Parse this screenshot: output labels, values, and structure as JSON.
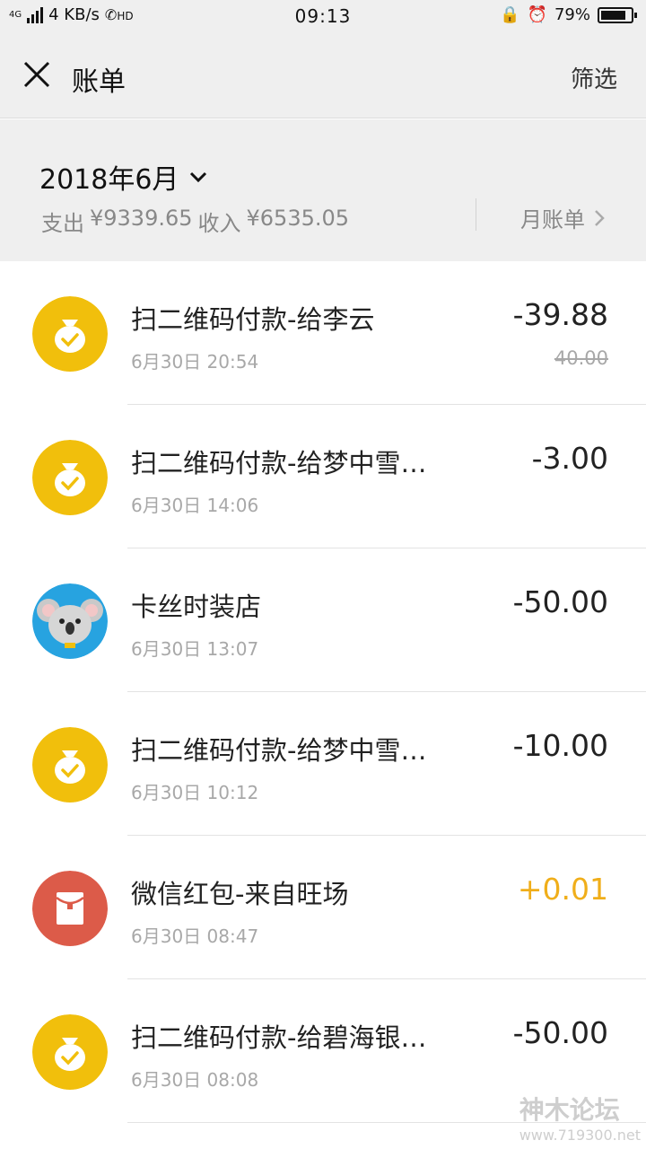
{
  "status_bar": {
    "network": "4G",
    "speed": "4 KB/s",
    "hd": "HD",
    "time": "09:13",
    "battery": "79%",
    "battery_level": 0.79
  },
  "nav": {
    "title": "账单",
    "filter_label": "筛选"
  },
  "summary": {
    "month": "2018年6月",
    "expense_label": "支出",
    "expense_value": "¥9339.65",
    "income_label": "收入",
    "income_value": "¥6535.05",
    "monthly_bill_label": "月账单"
  },
  "transactions": [
    {
      "icon": "money-bag-icon",
      "title": "扫二维码付款-给李云",
      "time": "6月30日 20:54",
      "amount": "-39.88",
      "original": "40.00"
    },
    {
      "icon": "money-bag-icon",
      "title": "扫二维码付款-给梦中雪…",
      "time": "6月30日 14:06",
      "amount": "-3.00",
      "original": ""
    },
    {
      "icon": "koala-avatar-icon",
      "title": "卡丝时装店",
      "time": "6月30日 13:07",
      "amount": "-50.00",
      "original": ""
    },
    {
      "icon": "money-bag-icon",
      "title": "扫二维码付款-给梦中雪…",
      "time": "6月30日 10:12",
      "amount": "-10.00",
      "original": ""
    },
    {
      "icon": "red-packet-icon",
      "title": "微信红包-来自旺场",
      "time": "6月30日 08:47",
      "amount": "+0.01",
      "original": ""
    },
    {
      "icon": "money-bag-icon",
      "title": "扫二维码付款-给碧海银…",
      "time": "6月30日 08:08",
      "amount": "-50.00",
      "original": ""
    }
  ],
  "colors": {
    "money_bag_bg": "#f1bf0c",
    "red_packet_bg": "#dc5b49",
    "koala_bg": "#27a3e0",
    "income_amount": "#f0ae1a"
  },
  "watermark": {
    "text": "神木论坛",
    "url": "www.719300.net"
  }
}
